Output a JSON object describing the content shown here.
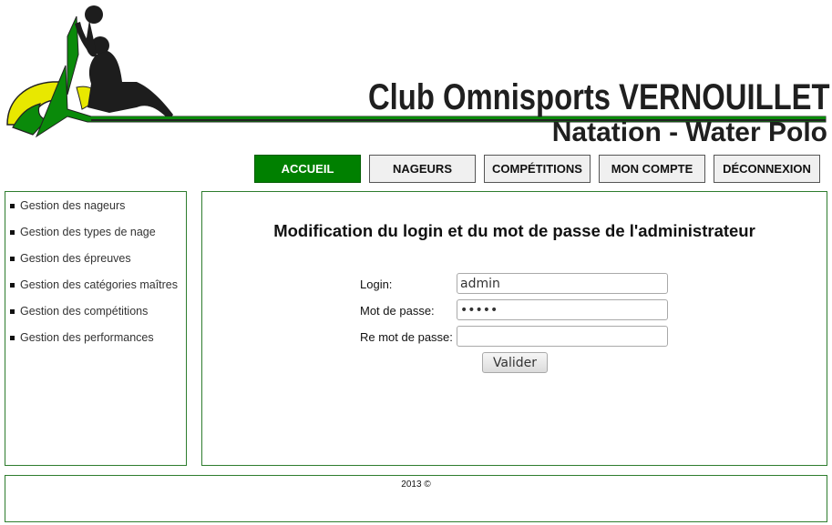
{
  "header": {
    "club_name": "Club Omnisports  VERNOUILLET",
    "subtitle": "Natation - Water Polo"
  },
  "nav": {
    "items": [
      {
        "label": "ACCUEIL",
        "active": true
      },
      {
        "label": "NAGEURS",
        "active": false
      },
      {
        "label": "COMPÉTITIONS",
        "active": false
      },
      {
        "label": "MON COMPTE",
        "active": false
      },
      {
        "label": "DÉCONNEXION",
        "active": false
      }
    ]
  },
  "sidebar": {
    "items": [
      {
        "label": "Gestion des nageurs"
      },
      {
        "label": "Gestion des types de nage"
      },
      {
        "label": "Gestion des épreuves"
      },
      {
        "label": "Gestion des catégories maîtres"
      },
      {
        "label": "Gestion des compétitions"
      },
      {
        "label": "Gestion des performances"
      }
    ]
  },
  "main": {
    "title": "Modification du login et du mot de passe de l'administrateur",
    "form": {
      "login_label": "Login:",
      "login_value": "admin",
      "password_label": "Mot de passe:",
      "password_value": "admin",
      "repassword_label": "Re mot de passe:",
      "repassword_value": "",
      "submit_label": "Valider"
    }
  },
  "footer": {
    "text": "2013 ©"
  },
  "colors": {
    "brand_green": "#008000",
    "logo_yellow": "#e8e800",
    "border_green": "#2e7d2e"
  },
  "icons": {
    "logo": "water-polo-player-logo"
  }
}
